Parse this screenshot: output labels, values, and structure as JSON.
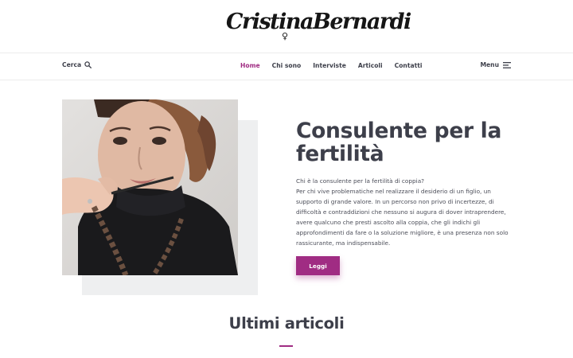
{
  "brand": {
    "logo_text": "CristinaBernardi",
    "accent_color": "#a02c83"
  },
  "nav": {
    "search_label": "Cerca",
    "search_icon": "search-icon",
    "links": [
      {
        "label": "Home",
        "active": true
      },
      {
        "label": "Chi sono",
        "active": false
      },
      {
        "label": "Interviste",
        "active": false
      },
      {
        "label": "Articoli",
        "active": false
      },
      {
        "label": "Contatti",
        "active": false
      }
    ],
    "menu_label": "Menu",
    "menu_icon": "hamburger-icon"
  },
  "hero": {
    "title": "Consulente per la fertilità",
    "paragraph_1": "Chi è la consulente per la fertilità di coppia?",
    "paragraph_2": "Per chi vive problematiche nel realizzare il desiderio di un figlio, un supporto di grande valore. In un percorso non privo di incertezze, di difficoltà e contraddizioni che nessuno si augura di dover intraprendere, avere qualcuno che presti ascolto alla coppia, che gli indichi gli approfondimenti da fare o la soluzione migliore, è una presenza non solo rassicurante, ma indispensabile.",
    "button_label": "Leggi"
  },
  "latest": {
    "title": "Ultimi articoli"
  }
}
